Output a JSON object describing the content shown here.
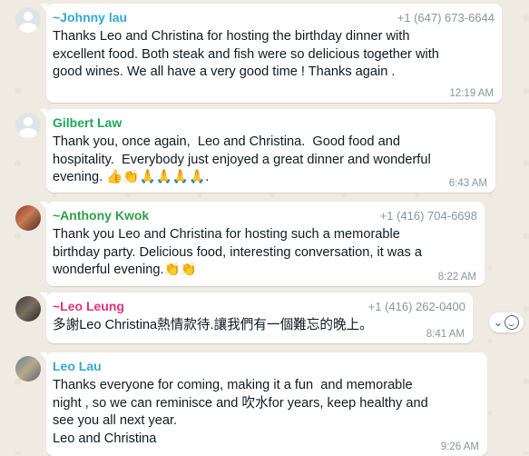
{
  "colors": {
    "background": "#efeae2",
    "bubble": "#ffffff",
    "meta_text": "#8696a0"
  },
  "messages": [
    {
      "sender": "~Johnny lau",
      "sender_color": "#35a8d6",
      "phone": "+1 (647) 673-6644",
      "text": "Thanks Leo and Christina for hosting the birthday dinner with\nexcellent food. Both steak and fish were so delicious together with\ngood wines. We all have a very good time ! Thanks again .",
      "time": "12:19 AM",
      "avatar": "default-avatar"
    },
    {
      "sender": "Gilbert Law",
      "sender_color": "#1fa855",
      "phone": "",
      "text": "Thank you, once again,  Leo and Christina.  Good food and\nhospitality.  Everybody just enjoyed a great dinner and wonderful\nevening. 👍👏🙏🙏🙏🙏.",
      "time": "6:43 AM",
      "avatar": "default-avatar"
    },
    {
      "sender": "~Anthony Kwok",
      "sender_color": "#2fa04a",
      "phone": "+1 (416) 704-6698",
      "text": "Thank you Leo and Christina for hosting such a memorable\nbirthday party. Delicious food, interesting conversation, it was a\nwonderful evening.👏👏",
      "time": "8:22 AM",
      "avatar": "photo-avatar"
    },
    {
      "sender": "~Leo Leung",
      "sender_color": "#e0317a",
      "phone": "+1 (416) 262-0400",
      "text": "多謝Leo Christina熱情款待.讓我們有一個難忘的晚上。",
      "time": "8:41 AM",
      "avatar": "photo-avatar"
    },
    {
      "sender": "Leo Lau",
      "sender_color": "#35a8d6",
      "phone": "",
      "text": "Thanks everyone for coming, making it a fun  and memorable\nnight , so we can reminisce and 吹水for years, keep healthy and\nsee you all next year.\nLeo and Christina",
      "time": "9:26 AM",
      "avatar": "photo-avatar"
    }
  ],
  "reaction_button": {
    "icon": "emoji-react-icon",
    "chevron": "⌄"
  }
}
